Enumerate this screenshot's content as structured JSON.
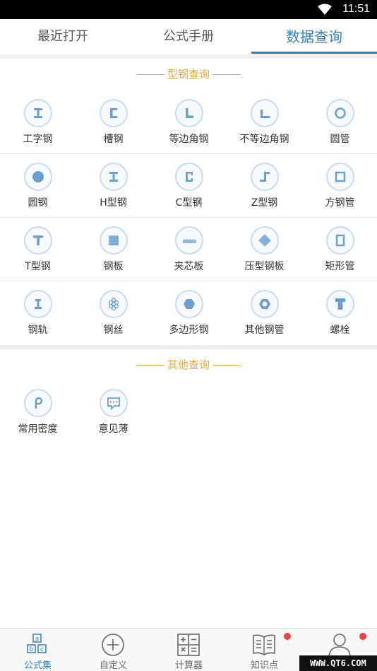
{
  "status_bar": {
    "time": "11:51"
  },
  "tabs": [
    {
      "label": "最近打开"
    },
    {
      "label": "公式手册"
    },
    {
      "label": "数据查询"
    }
  ],
  "active_tab": "数据查询",
  "accent_color": "#2f7fc1",
  "section_color": "#e8a93a",
  "section_steel": {
    "title": "型钢查询",
    "items": [
      {
        "label": "工字钢",
        "icon": "i-beam-icon"
      },
      {
        "label": "槽钢",
        "icon": "channel-steel-icon"
      },
      {
        "label": "等边角钢",
        "icon": "equal-angle-icon"
      },
      {
        "label": "不等边角钢",
        "icon": "unequal-angle-icon"
      },
      {
        "label": "圆管",
        "icon": "round-pipe-icon"
      },
      {
        "label": "圆钢",
        "icon": "round-bar-icon"
      },
      {
        "label": "H型钢",
        "icon": "h-beam-icon"
      },
      {
        "label": "C型钢",
        "icon": "c-steel-icon"
      },
      {
        "label": "Z型钢",
        "icon": "z-steel-icon"
      },
      {
        "label": "方钢管",
        "icon": "square-tube-icon"
      },
      {
        "label": "T型钢",
        "icon": "t-steel-icon"
      },
      {
        "label": "钢板",
        "icon": "steel-plate-icon"
      },
      {
        "label": "夹芯板",
        "icon": "sandwich-panel-icon"
      },
      {
        "label": "压型钢板",
        "icon": "profiled-sheet-icon"
      },
      {
        "label": "矩形管",
        "icon": "rect-tube-icon"
      },
      {
        "label": "钢轨",
        "icon": "rail-icon"
      },
      {
        "label": "钢丝",
        "icon": "steel-wire-icon"
      },
      {
        "label": "多边形钢",
        "icon": "polygon-steel-icon"
      },
      {
        "label": "其他钢管",
        "icon": "other-pipe-icon"
      },
      {
        "label": "螺栓",
        "icon": "bolt-icon"
      }
    ]
  },
  "section_other": {
    "title": "其他查询",
    "items": [
      {
        "label": "常用密度",
        "icon": "density-icon"
      },
      {
        "label": "意见薄",
        "icon": "feedback-icon"
      }
    ]
  },
  "bottom_nav": [
    {
      "label": "公式集",
      "icon": "formula-set-icon",
      "active": true
    },
    {
      "label": "自定义",
      "icon": "plus-circle-icon",
      "active": false
    },
    {
      "label": "计算器",
      "icon": "calculator-icon",
      "active": false
    },
    {
      "label": "知识点",
      "icon": "book-icon",
      "active": false
    },
    {
      "label": "",
      "icon": "user-icon",
      "active": false
    }
  ],
  "watermark": "WWW.QT6.COM"
}
